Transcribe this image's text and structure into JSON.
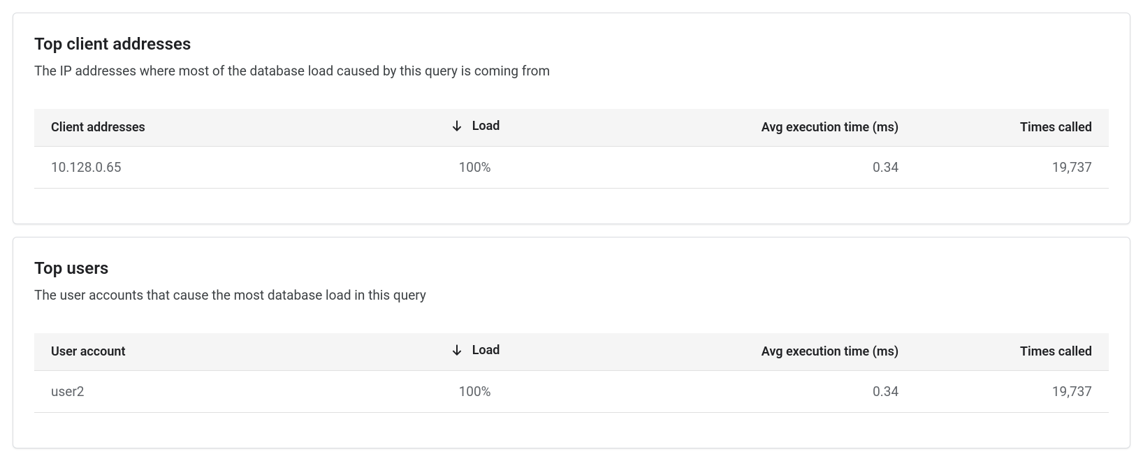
{
  "top_clients": {
    "title": "Top client addresses",
    "subtitle": "The IP addresses where most of the database load caused by this query is coming from",
    "columns": {
      "first": "Client addresses",
      "load": "Load",
      "avg_exec": "Avg execution time (ms)",
      "times_called": "Times called"
    },
    "rows": [
      {
        "address": "10.128.0.65",
        "load": "100%",
        "avg_exec": "0.34",
        "times_called": "19,737"
      }
    ]
  },
  "top_users": {
    "title": "Top users",
    "subtitle": "The user accounts that cause the most database load in this query",
    "columns": {
      "first": "User account",
      "load": "Load",
      "avg_exec": "Avg execution time (ms)",
      "times_called": "Times called"
    },
    "rows": [
      {
        "account": "user2",
        "load": "100%",
        "avg_exec": "0.34",
        "times_called": "19,737"
      }
    ]
  }
}
